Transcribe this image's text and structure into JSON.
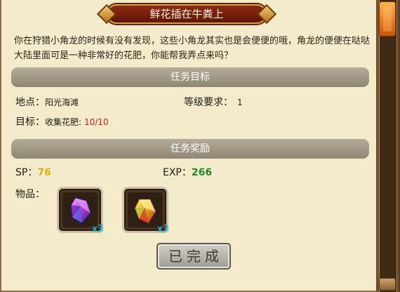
{
  "title": "鲜花插在牛粪上",
  "description": "你在狩猎小角龙的时候有没有发现，这些小角龙其实也是会便便的哦，角龙的便便在哒哒大陆里面可是一种非常好的花肥，你能帮我弄点来吗？",
  "objective_section": {
    "header": "任务目标",
    "location_label": "地点：",
    "location_value": "阳光海滩",
    "level_label": "等级要求：",
    "level_value": "1",
    "target_label": "目标：",
    "target_value": "收集花肥:",
    "target_progress": "10/10"
  },
  "reward_section": {
    "header": "任务奖励",
    "sp_label": "SP：",
    "sp_value": "76",
    "exp_label": "EXP：",
    "exp_value": "266",
    "items_label": "物品：",
    "items": [
      {
        "icon": "purple-crystal-icon",
        "quantity": "x3"
      },
      {
        "icon": "gold-crystal-icon",
        "quantity": "x3"
      }
    ]
  },
  "complete_button": "已完成",
  "colors": {
    "panel_bg": "#f4ebcc",
    "banner": "#7a1e0a",
    "section_bar": "#a39a86",
    "sp_value": "#d8b400",
    "exp_value": "#1e8a1e",
    "progress": "#cc1a10",
    "quantity": "#22e0ff"
  }
}
